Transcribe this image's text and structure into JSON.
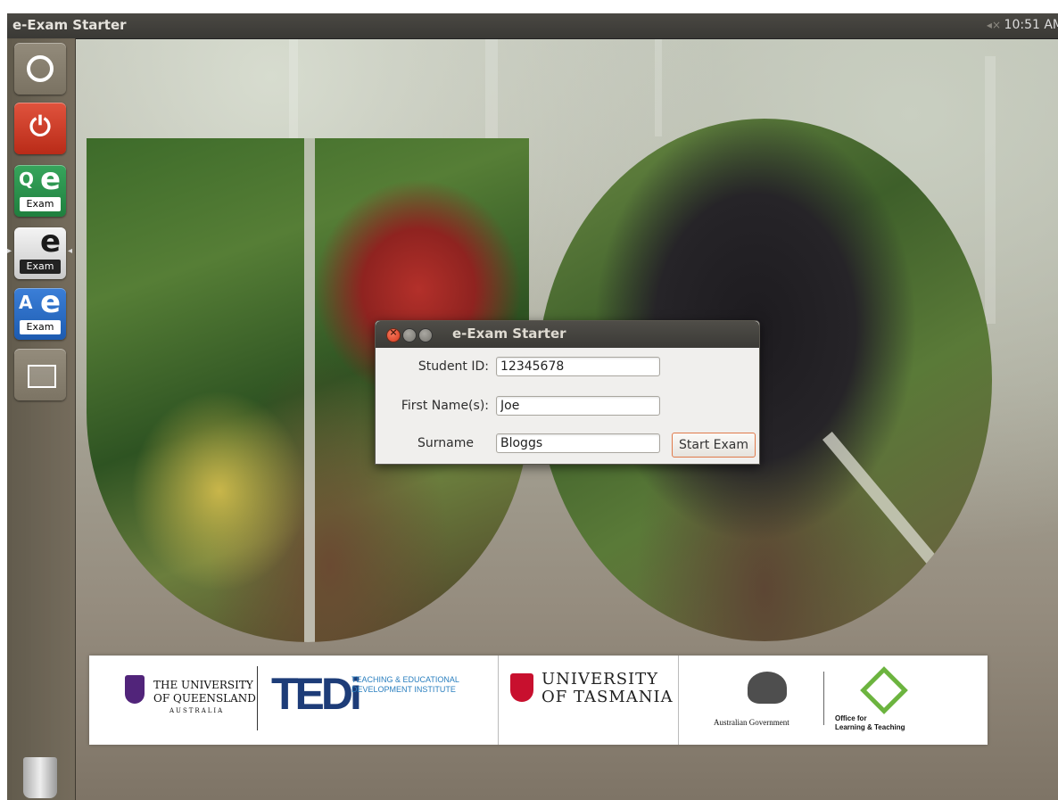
{
  "panel": {
    "title": "e-Exam Starter",
    "volume_icon": "◂×",
    "clock": "10:51 AM"
  },
  "launcher": {
    "items": [
      {
        "name": "dash",
        "icon": "ubuntu-logo-icon"
      },
      {
        "name": "shutdown",
        "icon": "power-icon",
        "glyph": "⏻"
      },
      {
        "name": "qe-exam",
        "letter": "Q",
        "big": "e",
        "caption": "Exam"
      },
      {
        "name": "e-exam",
        "letter": "",
        "big": "e",
        "caption": "Exam"
      },
      {
        "name": "ae-exam",
        "letter": "A",
        "big": "e",
        "caption": "Exam"
      },
      {
        "name": "workspace",
        "icon": "window-icon"
      },
      {
        "name": "trash",
        "icon": "trash-icon"
      }
    ]
  },
  "dialog": {
    "title": "e-Exam Starter",
    "student_id_label": "Student ID:",
    "student_id_value": "12345678",
    "first_name_label": "First Name(s):",
    "first_name_value": "Joe",
    "surname_label": "Surname",
    "surname_value": "Bloggs",
    "start_button": "Start Exam"
  },
  "logos": {
    "uq_line1": "THE UNIVERSITY",
    "uq_line2": "OF QUEENSLAND",
    "uq_sub": "AUSTRALIA",
    "tedi_logo": "TEDi",
    "tedi_line1": "TEACHING & EDUCATIONAL",
    "tedi_line2": "DEVELOPMENT INSTITUTE",
    "utas_line1": "UNIVERSITY",
    "utas_line2": "OF TASMANIA",
    "aus_gov": "Australian Government",
    "olt_line1": "Office for",
    "olt_line2": "Learning & Teaching"
  },
  "colors": {
    "accent": "#e07a4a",
    "close": "#d8391c",
    "uq_purple": "#51247a",
    "tedi_blue": "#1d3c78",
    "olt_green": "#6cb43f"
  }
}
